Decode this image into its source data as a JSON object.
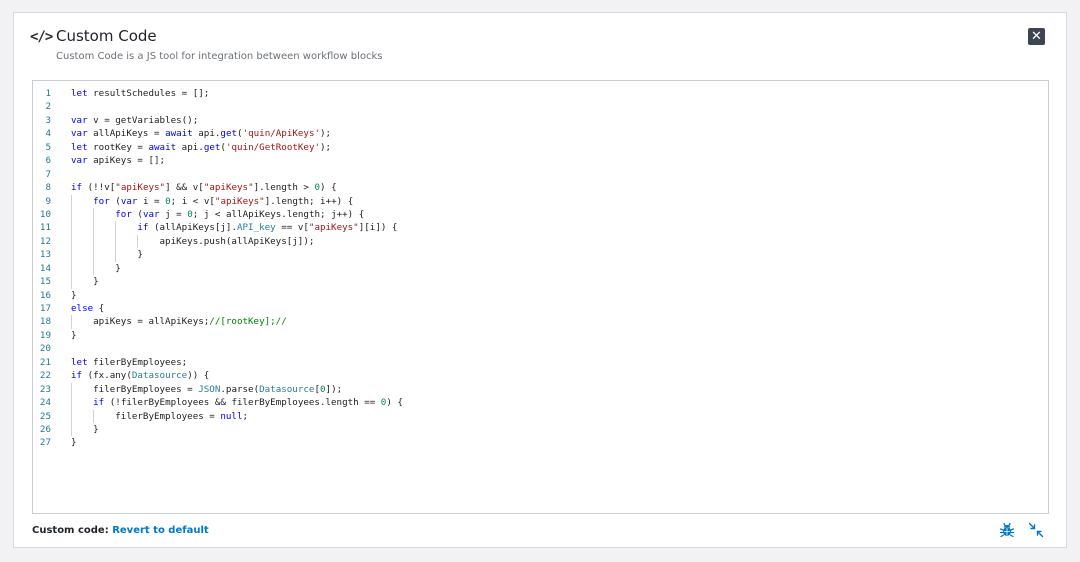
{
  "header": {
    "icon": "code-icon",
    "icon_glyph": "</>",
    "title": "Custom Code",
    "subtitle": "Custom Code is a JS tool for integration between workflow blocks",
    "close_glyph": "✕"
  },
  "editor": {
    "lines": [
      [
        [
          "k",
          "let"
        ],
        [
          "t",
          " resultSchedules = [];"
        ]
      ],
      [],
      [
        [
          "k",
          "var"
        ],
        [
          "t",
          " v = getVariables();"
        ]
      ],
      [
        [
          "k",
          "var"
        ],
        [
          "t",
          " allApiKeys = "
        ],
        [
          "k",
          "await"
        ],
        [
          "t",
          " api."
        ],
        [
          "k",
          "get"
        ],
        [
          "t",
          "("
        ],
        [
          "s",
          "'quin/ApiKeys'"
        ],
        [
          "t",
          ");"
        ]
      ],
      [
        [
          "k",
          "let"
        ],
        [
          "t",
          " rootKey = "
        ],
        [
          "k",
          "await"
        ],
        [
          "t",
          " api."
        ],
        [
          "k",
          "get"
        ],
        [
          "t",
          "("
        ],
        [
          "s",
          "'quin/GetRootKey'"
        ],
        [
          "t",
          ");"
        ]
      ],
      [
        [
          "k",
          "var"
        ],
        [
          "t",
          " apiKeys = [];"
        ]
      ],
      [],
      [
        [
          "k",
          "if"
        ],
        [
          "t",
          " (!!v["
        ],
        [
          "s",
          "\"apiKeys\""
        ],
        [
          "t",
          "] && v["
        ],
        [
          "s",
          "\"apiKeys\""
        ],
        [
          "t",
          "].length > "
        ],
        [
          "n",
          "0"
        ],
        [
          "t",
          ") {"
        ]
      ],
      [
        [
          "t",
          "    "
        ],
        [
          "k",
          "for"
        ],
        [
          "t",
          " ("
        ],
        [
          "k",
          "var"
        ],
        [
          "t",
          " i = "
        ],
        [
          "n",
          "0"
        ],
        [
          "t",
          "; i < v["
        ],
        [
          "s",
          "\"apiKeys\""
        ],
        [
          "t",
          "].length; i++) {"
        ]
      ],
      [
        [
          "t",
          "        "
        ],
        [
          "k",
          "for"
        ],
        [
          "t",
          " ("
        ],
        [
          "k",
          "var"
        ],
        [
          "t",
          " j = "
        ],
        [
          "n",
          "0"
        ],
        [
          "t",
          "; j < allApiKeys.length; j++) {"
        ]
      ],
      [
        [
          "t",
          "            "
        ],
        [
          "k",
          "if"
        ],
        [
          "t",
          " (allApiKeys[j]."
        ],
        [
          "p",
          "API_key"
        ],
        [
          "t",
          " == v["
        ],
        [
          "s",
          "\"apiKeys\""
        ],
        [
          "t",
          "][i]) {"
        ]
      ],
      [
        [
          "t",
          "                apiKeys.push(allApiKeys[j]);"
        ]
      ],
      [
        [
          "t",
          "            }"
        ]
      ],
      [
        [
          "t",
          "        }"
        ]
      ],
      [
        [
          "t",
          "    }"
        ]
      ],
      [
        [
          "t",
          "}"
        ]
      ],
      [
        [
          "k",
          "else"
        ],
        [
          "t",
          " {"
        ]
      ],
      [
        [
          "t",
          "    apiKeys = allApiKeys;"
        ],
        [
          "c",
          "//[rootKey];//"
        ]
      ],
      [
        [
          "t",
          "}"
        ]
      ],
      [],
      [
        [
          "k",
          "let"
        ],
        [
          "t",
          " filerByEmployees;"
        ]
      ],
      [
        [
          "k",
          "if"
        ],
        [
          "t",
          " (fx.any("
        ],
        [
          "p",
          "Datasource"
        ],
        [
          "t",
          ")) {"
        ]
      ],
      [
        [
          "t",
          "    filerByEmployees = "
        ],
        [
          "p",
          "JSON"
        ],
        [
          "t",
          ".parse("
        ],
        [
          "p",
          "Datasource"
        ],
        [
          "t",
          "["
        ],
        [
          "n",
          "0"
        ],
        [
          "t",
          "]);"
        ]
      ],
      [
        [
          "t",
          "    "
        ],
        [
          "k",
          "if"
        ],
        [
          "t",
          " (!filerByEmployees && filerByEmployees.length == "
        ],
        [
          "n",
          "0"
        ],
        [
          "t",
          ") {"
        ]
      ],
      [
        [
          "t",
          "        filerByEmployees = "
        ],
        [
          "k",
          "null"
        ],
        [
          "t",
          ";"
        ]
      ],
      [
        [
          "t",
          "    }"
        ]
      ],
      [
        [
          "t",
          "}"
        ]
      ]
    ],
    "indent_guides": [
      [],
      [],
      [],
      [],
      [],
      [],
      [],
      [],
      [
        0
      ],
      [
        0,
        1
      ],
      [
        0,
        1,
        2
      ],
      [
        0,
        1,
        2,
        3
      ],
      [
        0,
        1,
        2
      ],
      [
        0,
        1
      ],
      [
        0
      ],
      [],
      [],
      [
        0
      ],
      [],
      [],
      [],
      [],
      [
        0
      ],
      [
        0
      ],
      [
        0,
        1
      ],
      [
        0
      ],
      []
    ]
  },
  "footer": {
    "label": "Custom code:",
    "link": "Revert to default",
    "debug_icon": "bug-icon",
    "collapse_icon": "collapse-arrows-icon"
  },
  "colors": {
    "keyword": "#0000ff",
    "string": "#a31515",
    "number": "#098658",
    "comment": "#008000",
    "link": "#0077cc",
    "line_number": "#237893"
  }
}
